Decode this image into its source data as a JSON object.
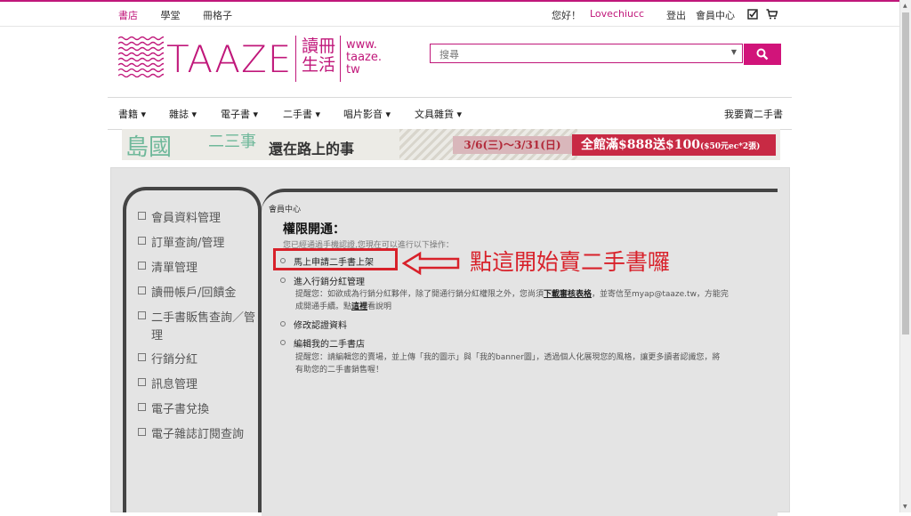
{
  "topbar": {
    "tabs": [
      "書店",
      "學堂",
      "冊格子"
    ],
    "greeting": "您好！",
    "username": "Lovechiucc",
    "logout": "登出",
    "member_center": "會員中心"
  },
  "logo": {
    "brand": "TAAZE",
    "chinese_line1": "讀冊",
    "chinese_line2": "生活",
    "site_line1": "www.",
    "site_line2": "taaze.",
    "site_line3": "tw"
  },
  "search": {
    "placeholder": "搜尋"
  },
  "nav": {
    "items": [
      "書籍",
      "雜誌",
      "電子書",
      "二手書",
      "唱片影音",
      "文具雜貨"
    ],
    "right_link": "我要賣二手書"
  },
  "banner": {
    "title_a": "島國",
    "title_b": "二三事",
    "title_c": "還在路上的事",
    "date_range": "3/6(三)～3/31(日)",
    "promo": "全館滿$888送$100",
    "promo_note": "($50元ec*2張)"
  },
  "sidebar": {
    "items": [
      "會員資料管理",
      "訂單查詢/管理",
      "清單管理",
      "讀冊帳戶/回饋金",
      "二手書販售查詢／管理",
      "行銷分紅",
      "訊息管理",
      "電子書兌換",
      "電子雜誌訂閱查詢"
    ]
  },
  "content": {
    "breadcrumb": "會員中心",
    "title": "權限開通：",
    "subtitle": "您已經通過手機認證,您現在可以進行以下操作：",
    "option1": "馬上申請二手書上架",
    "option2": "進入行銷分紅管理",
    "option2_note_a": "提醒您：如欲成為行銷分紅夥伴，除了開通行銷分紅權限之外，您尚須",
    "option2_note_link": "下載審核表格",
    "option2_note_b": "，並寄信至myap@taaze.tw，方能完",
    "option2_note_c": "成開通手續。點",
    "option2_note_link2": "這裡",
    "option2_note_d": "看說明",
    "option3": "修改認證資料",
    "option4": "編輯我的二手書店",
    "option4_note_a": "提醒您：請編輯您的賣場，並上傳「我的圖示」與「我的banner圖」，透過個人化展現您的風格，讓更多讀者認識您，將",
    "option4_note_b": "有助您的二手書銷售喔！"
  },
  "annotation": {
    "text": "點這開始賣二手書囉"
  },
  "colors": {
    "brand": "#c0177a",
    "annotation": "#d8212a"
  },
  "icons": [
    "checklist-icon",
    "cart-icon",
    "search-icon",
    "chevron-down-icon",
    "arrow-left-icon"
  ]
}
